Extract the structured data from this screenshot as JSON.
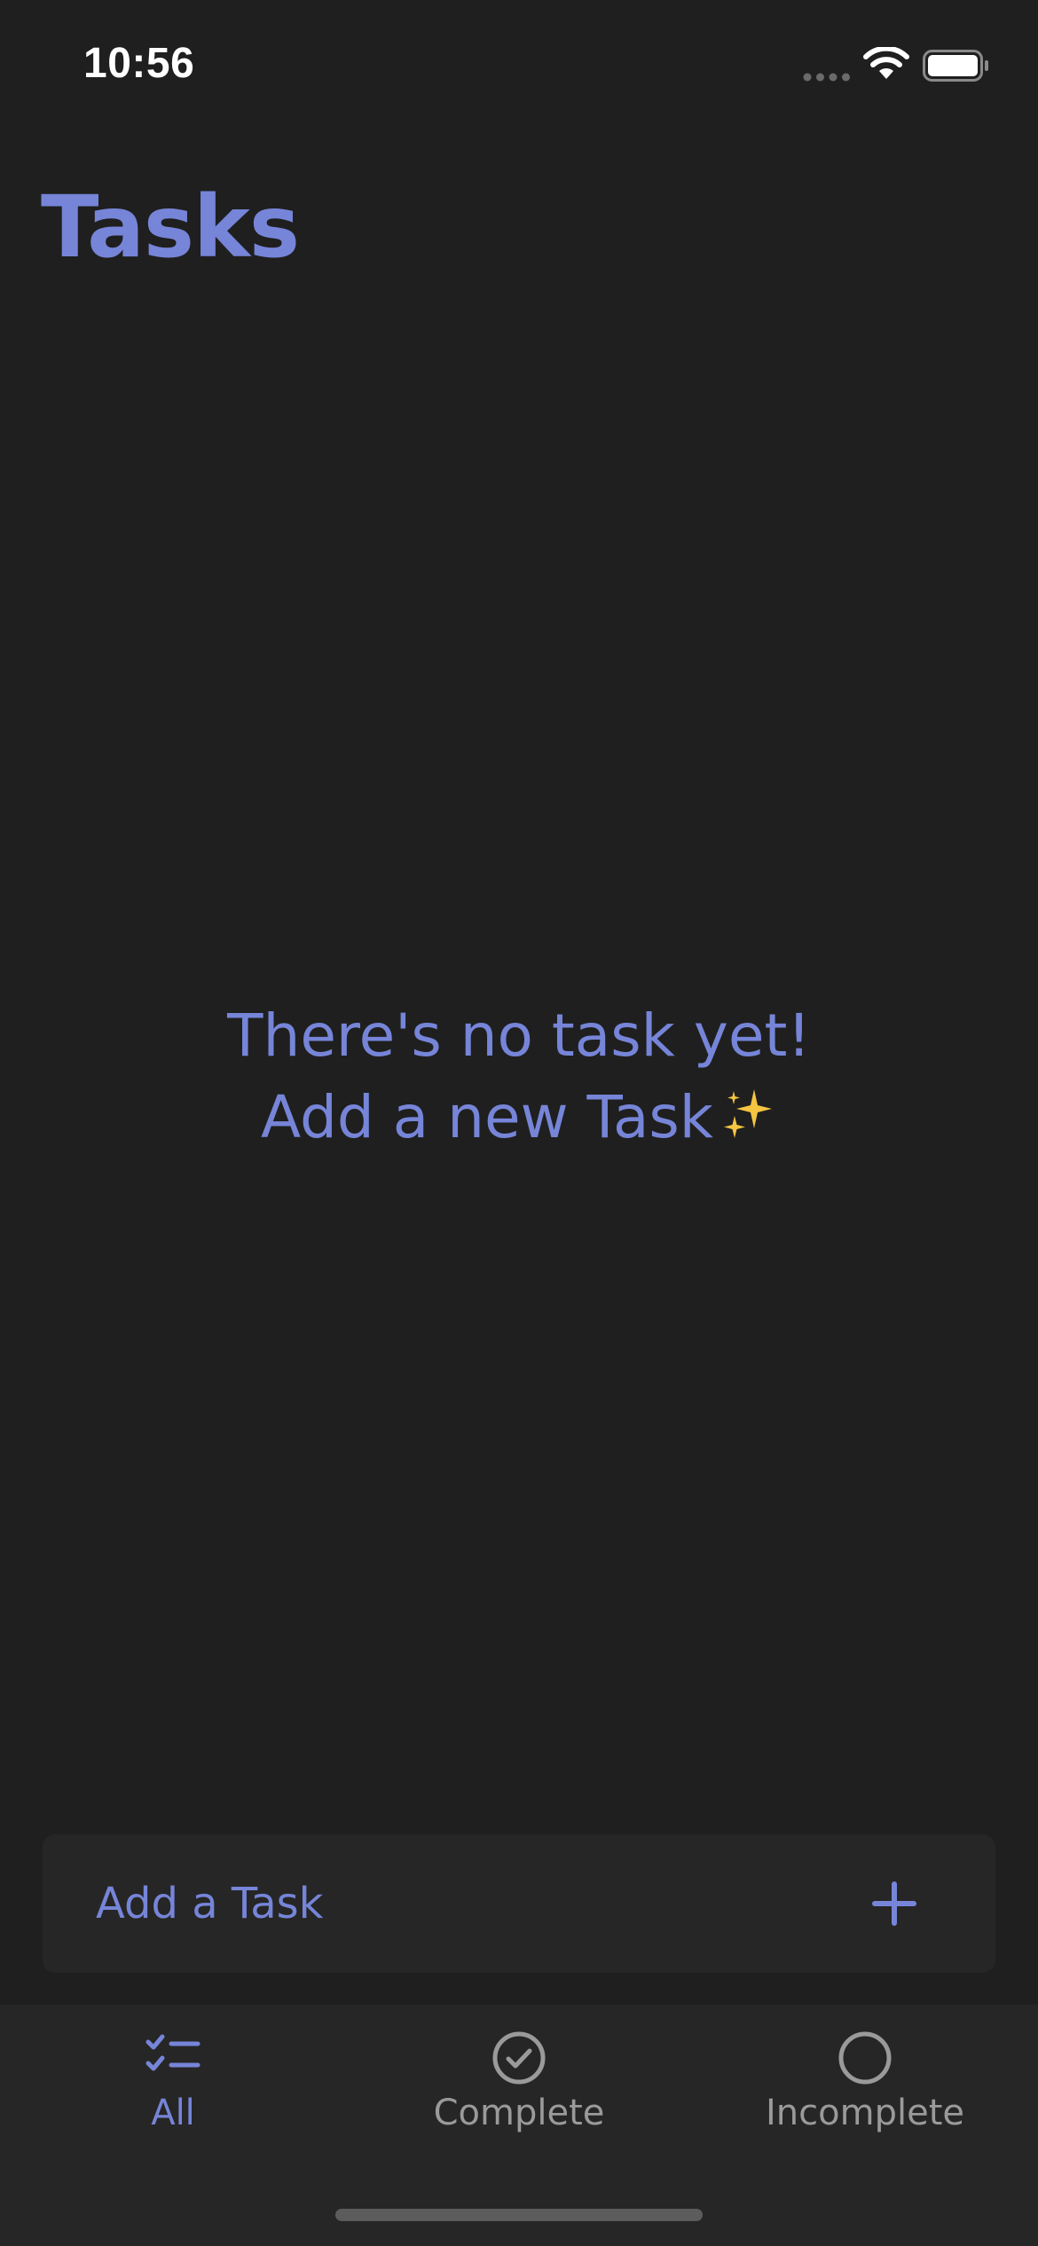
{
  "status_bar": {
    "time": "10:56"
  },
  "header": {
    "title": "Tasks"
  },
  "empty_state": {
    "line1": "There's no task yet!",
    "line2": "Add a new Task",
    "emoji": "✨"
  },
  "add_task": {
    "placeholder": "Add a Task",
    "add_icon": "plus-icon"
  },
  "tab_bar": {
    "tabs": [
      {
        "label": "All",
        "icon": "checklist-icon",
        "selected": true
      },
      {
        "label": "Complete",
        "icon": "checkmark-circle-icon",
        "selected": false
      },
      {
        "label": "Incomplete",
        "icon": "circle-icon",
        "selected": false
      }
    ]
  },
  "colors": {
    "background": "#1f1f1f",
    "surface": "#262626",
    "accent": "#7685d8",
    "inactive": "#9a9a9a",
    "sparkle": "#f5c542"
  }
}
